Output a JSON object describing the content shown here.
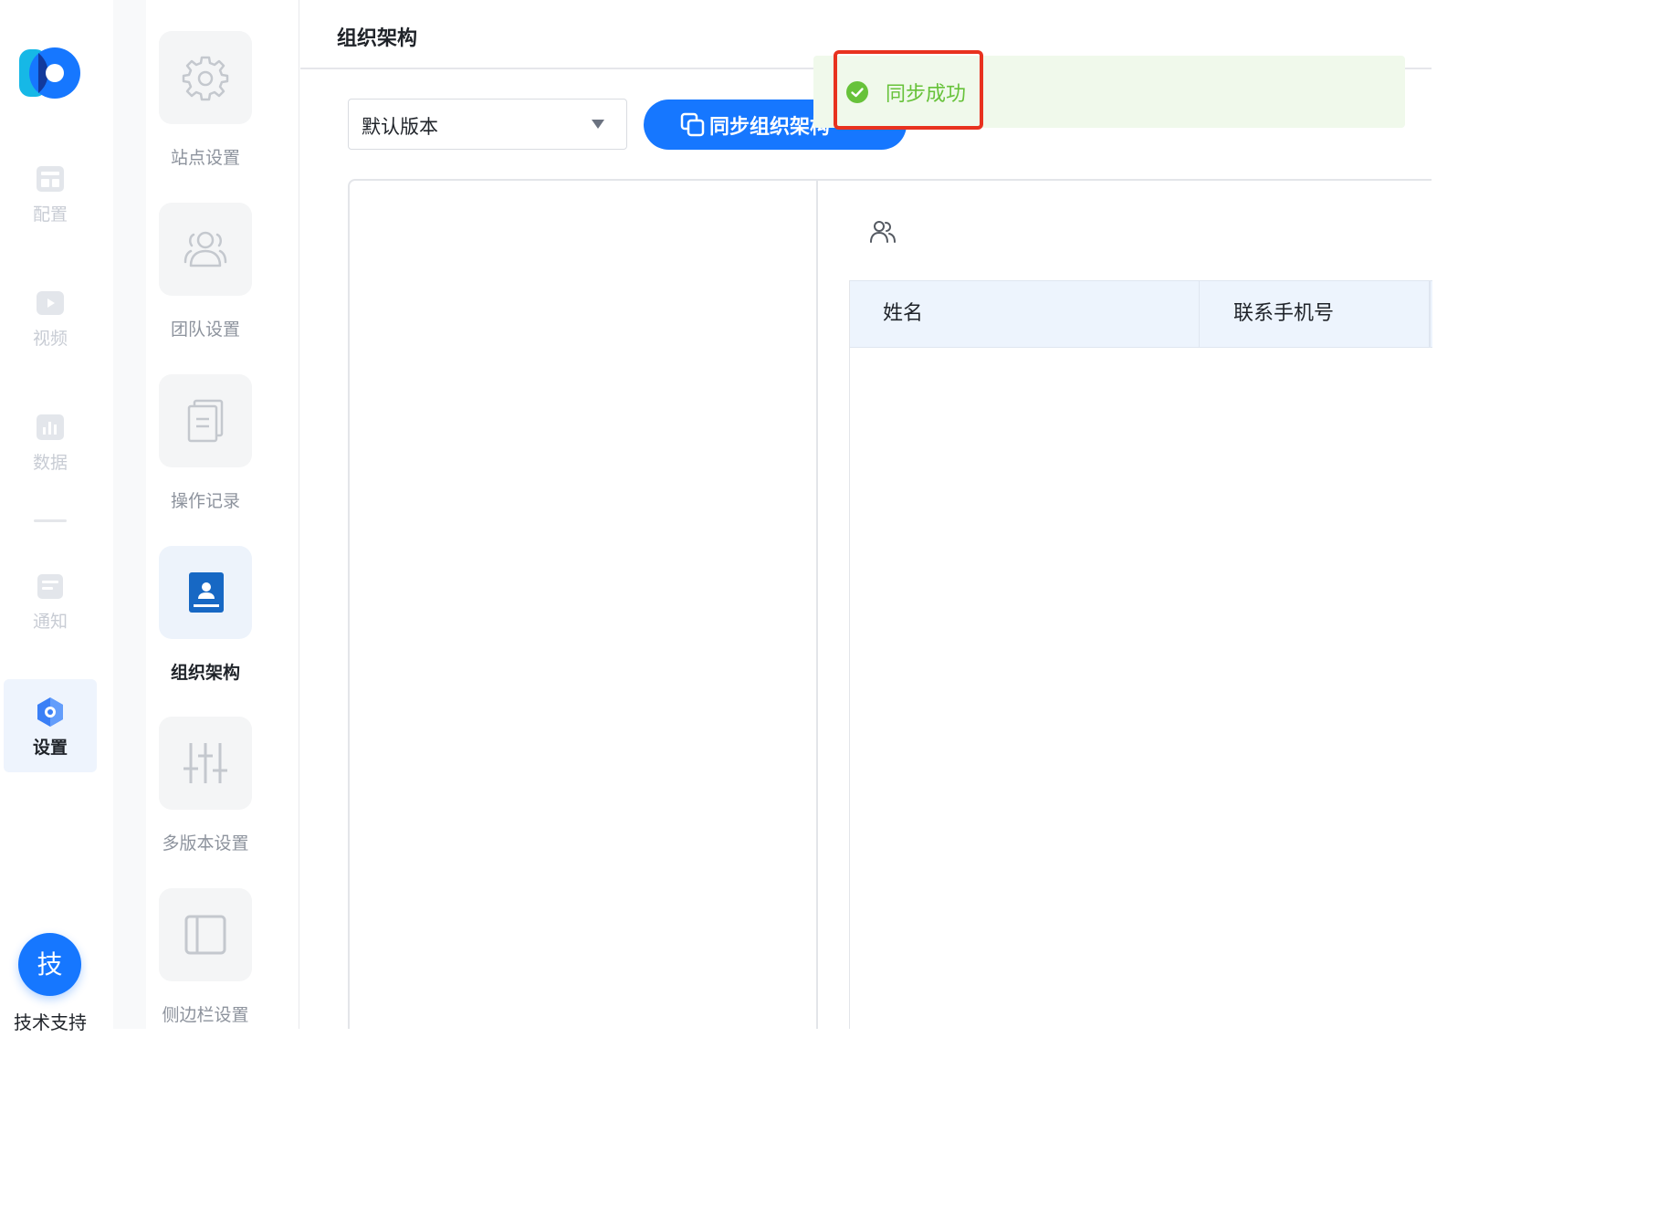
{
  "rail": {
    "items": [
      {
        "label": "配置",
        "icon": "layout-icon"
      },
      {
        "label": "视频",
        "icon": "video-icon"
      },
      {
        "label": "数据",
        "icon": "chart-icon"
      },
      {
        "label": "通知",
        "icon": "notice-icon"
      },
      {
        "label": "设置",
        "icon": "settings-hex-icon",
        "active": true
      }
    ],
    "support_button": "技",
    "support_label": "技术支持"
  },
  "settings_menu": {
    "items": [
      {
        "label": "站点设置",
        "icon": "gear-icon"
      },
      {
        "label": "团队设置",
        "icon": "team-icon"
      },
      {
        "label": "操作记录",
        "icon": "document-icon"
      },
      {
        "label": "组织架构",
        "icon": "contact-book-icon",
        "active": true
      },
      {
        "label": "多版本设置",
        "icon": "sliders-icon"
      },
      {
        "label": "侧边栏设置",
        "icon": "sidebar-icon"
      }
    ]
  },
  "main": {
    "title": "组织架构",
    "version_select": {
      "value": "默认版本"
    },
    "sync_button": "同步组织架构",
    "table": {
      "columns": [
        "姓名",
        "联系手机号"
      ]
    }
  },
  "toast": {
    "text": "同步成功",
    "type": "success"
  },
  "colors": {
    "primary": "#1677ff",
    "success": "#67c23a",
    "success_bg": "#f0f9eb",
    "highlight": "#e8321f"
  }
}
